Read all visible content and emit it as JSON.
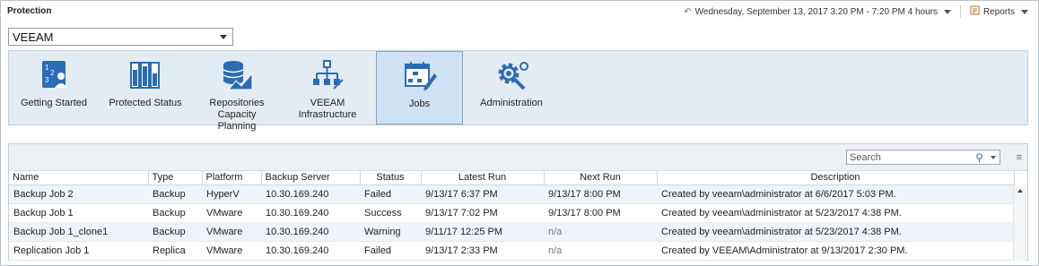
{
  "header": {
    "title": "Protection",
    "time_range": "Wednesday, September 13, 2017 3:20 PM - 7:20 PM 4 hours",
    "reports_label": "Reports"
  },
  "selector": {
    "value": "VEEAM"
  },
  "tiles": [
    {
      "label": "Getting Started",
      "icon": "getting-started-icon"
    },
    {
      "label": "Protected Status",
      "icon": "protected-status-icon"
    },
    {
      "label": "Repositories Capacity Planning",
      "icon": "repositories-icon"
    },
    {
      "label": "VEEAM Infrastructure",
      "icon": "infrastructure-icon"
    },
    {
      "label": "Jobs",
      "icon": "jobs-icon",
      "selected": true
    },
    {
      "label": "Administration",
      "icon": "administration-icon"
    }
  ],
  "search": {
    "placeholder": "Search"
  },
  "table": {
    "columns": [
      "Name",
      "Type",
      "Platform",
      "Backup Server",
      "Status",
      "Latest Run",
      "Next Run",
      "Description"
    ],
    "rows": [
      [
        "Backup Job 2",
        "Backup",
        "HyperV",
        "10.30.169.240",
        "Failed",
        "9/13/17 6:37 PM",
        "9/13/17 8:00 PM",
        "Created by veeam\\administrator at 6/6/2017 5:03 PM."
      ],
      [
        "Backup Job 1",
        "Backup",
        "VMware",
        "10.30.169.240",
        "Success",
        "9/13/17 7:02 PM",
        "9/13/17 8:00 PM",
        "Created by veeam\\administrator at 5/23/2017 4:38 PM."
      ],
      [
        "Backup Job 1_clone1",
        "Backup",
        "VMware",
        "10.30.169.240",
        "Warning",
        "9/11/17 12:25 PM",
        "n/a",
        "Created by veeam\\administrator at 5/23/2017 4:38 PM."
      ],
      [
        "Replication Job 1",
        "Replica",
        "VMware",
        "10.30.169.240",
        "Failed",
        "9/13/17 2:33 PM",
        "n/a",
        "Created by VEEAM\\Administrator at 9/13/2017 2:30 PM."
      ]
    ]
  },
  "colors": {
    "accent": "#2a6db5",
    "tile_bg": "#e4ecf3",
    "selected_tile": "#cfe2f4"
  }
}
